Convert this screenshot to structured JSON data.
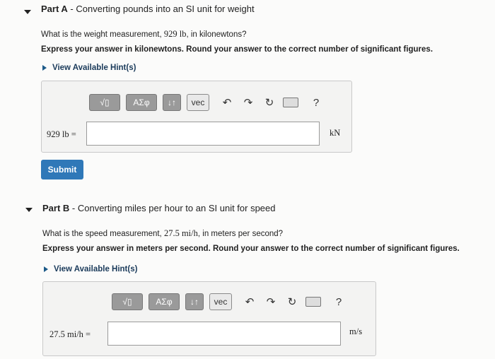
{
  "partA": {
    "title_bold": "Part A",
    "title_rest": " - Converting pounds into an SI unit for weight",
    "question_pre": "What is the weight measurement, ",
    "question_math": "929 lb",
    "question_post": ", in kilonewtons?",
    "instructions": "Express your answer in kilonewtons. Round your answer to the correct number of significant figures.",
    "hint": "View Available Hint(s)",
    "label": "929 lb =",
    "unit": "kN",
    "submit": "Submit"
  },
  "partB": {
    "title_bold": "Part B",
    "title_rest": " - Converting miles per hour to an SI unit for speed",
    "question_pre": "What is the speed measurement, ",
    "question_math": "27.5 mi/h",
    "question_post": ", in meters per second?",
    "instructions": "Express your answer in meters per second. Round your answer to the correct number of significant figures.",
    "hint": "View Available Hint(s)",
    "label": "27.5 mi/h =",
    "unit": "m/s"
  },
  "toolbar": {
    "sym1": "√▯",
    "greek": "ΑΣφ",
    "arrows": "↓↑",
    "vec": "vec",
    "undo": "↶",
    "redo": "↷",
    "reset": "↻",
    "help": "?"
  }
}
